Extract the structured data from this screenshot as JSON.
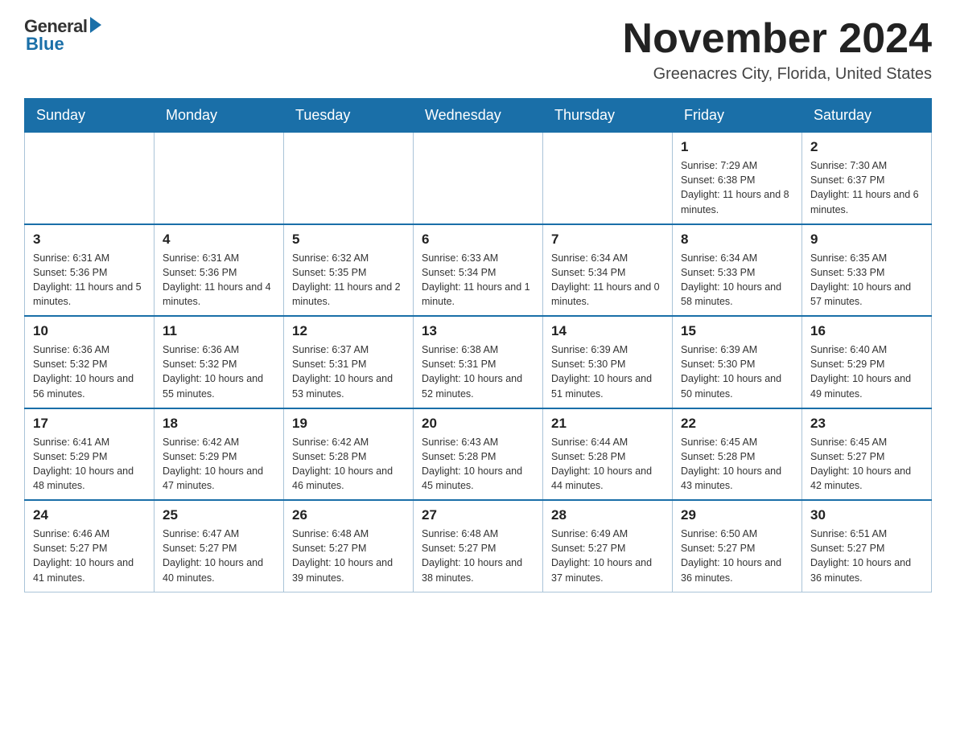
{
  "logo": {
    "general": "General",
    "blue": "Blue"
  },
  "title": "November 2024",
  "location": "Greenacres City, Florida, United States",
  "weekdays": [
    "Sunday",
    "Monday",
    "Tuesday",
    "Wednesday",
    "Thursday",
    "Friday",
    "Saturday"
  ],
  "weeks": [
    [
      {
        "day": "",
        "info": ""
      },
      {
        "day": "",
        "info": ""
      },
      {
        "day": "",
        "info": ""
      },
      {
        "day": "",
        "info": ""
      },
      {
        "day": "",
        "info": ""
      },
      {
        "day": "1",
        "info": "Sunrise: 7:29 AM\nSunset: 6:38 PM\nDaylight: 11 hours and 8 minutes."
      },
      {
        "day": "2",
        "info": "Sunrise: 7:30 AM\nSunset: 6:37 PM\nDaylight: 11 hours and 6 minutes."
      }
    ],
    [
      {
        "day": "3",
        "info": "Sunrise: 6:31 AM\nSunset: 5:36 PM\nDaylight: 11 hours and 5 minutes."
      },
      {
        "day": "4",
        "info": "Sunrise: 6:31 AM\nSunset: 5:36 PM\nDaylight: 11 hours and 4 minutes."
      },
      {
        "day": "5",
        "info": "Sunrise: 6:32 AM\nSunset: 5:35 PM\nDaylight: 11 hours and 2 minutes."
      },
      {
        "day": "6",
        "info": "Sunrise: 6:33 AM\nSunset: 5:34 PM\nDaylight: 11 hours and 1 minute."
      },
      {
        "day": "7",
        "info": "Sunrise: 6:34 AM\nSunset: 5:34 PM\nDaylight: 11 hours and 0 minutes."
      },
      {
        "day": "8",
        "info": "Sunrise: 6:34 AM\nSunset: 5:33 PM\nDaylight: 10 hours and 58 minutes."
      },
      {
        "day": "9",
        "info": "Sunrise: 6:35 AM\nSunset: 5:33 PM\nDaylight: 10 hours and 57 minutes."
      }
    ],
    [
      {
        "day": "10",
        "info": "Sunrise: 6:36 AM\nSunset: 5:32 PM\nDaylight: 10 hours and 56 minutes."
      },
      {
        "day": "11",
        "info": "Sunrise: 6:36 AM\nSunset: 5:32 PM\nDaylight: 10 hours and 55 minutes."
      },
      {
        "day": "12",
        "info": "Sunrise: 6:37 AM\nSunset: 5:31 PM\nDaylight: 10 hours and 53 minutes."
      },
      {
        "day": "13",
        "info": "Sunrise: 6:38 AM\nSunset: 5:31 PM\nDaylight: 10 hours and 52 minutes."
      },
      {
        "day": "14",
        "info": "Sunrise: 6:39 AM\nSunset: 5:30 PM\nDaylight: 10 hours and 51 minutes."
      },
      {
        "day": "15",
        "info": "Sunrise: 6:39 AM\nSunset: 5:30 PM\nDaylight: 10 hours and 50 minutes."
      },
      {
        "day": "16",
        "info": "Sunrise: 6:40 AM\nSunset: 5:29 PM\nDaylight: 10 hours and 49 minutes."
      }
    ],
    [
      {
        "day": "17",
        "info": "Sunrise: 6:41 AM\nSunset: 5:29 PM\nDaylight: 10 hours and 48 minutes."
      },
      {
        "day": "18",
        "info": "Sunrise: 6:42 AM\nSunset: 5:29 PM\nDaylight: 10 hours and 47 minutes."
      },
      {
        "day": "19",
        "info": "Sunrise: 6:42 AM\nSunset: 5:28 PM\nDaylight: 10 hours and 46 minutes."
      },
      {
        "day": "20",
        "info": "Sunrise: 6:43 AM\nSunset: 5:28 PM\nDaylight: 10 hours and 45 minutes."
      },
      {
        "day": "21",
        "info": "Sunrise: 6:44 AM\nSunset: 5:28 PM\nDaylight: 10 hours and 44 minutes."
      },
      {
        "day": "22",
        "info": "Sunrise: 6:45 AM\nSunset: 5:28 PM\nDaylight: 10 hours and 43 minutes."
      },
      {
        "day": "23",
        "info": "Sunrise: 6:45 AM\nSunset: 5:27 PM\nDaylight: 10 hours and 42 minutes."
      }
    ],
    [
      {
        "day": "24",
        "info": "Sunrise: 6:46 AM\nSunset: 5:27 PM\nDaylight: 10 hours and 41 minutes."
      },
      {
        "day": "25",
        "info": "Sunrise: 6:47 AM\nSunset: 5:27 PM\nDaylight: 10 hours and 40 minutes."
      },
      {
        "day": "26",
        "info": "Sunrise: 6:48 AM\nSunset: 5:27 PM\nDaylight: 10 hours and 39 minutes."
      },
      {
        "day": "27",
        "info": "Sunrise: 6:48 AM\nSunset: 5:27 PM\nDaylight: 10 hours and 38 minutes."
      },
      {
        "day": "28",
        "info": "Sunrise: 6:49 AM\nSunset: 5:27 PM\nDaylight: 10 hours and 37 minutes."
      },
      {
        "day": "29",
        "info": "Sunrise: 6:50 AM\nSunset: 5:27 PM\nDaylight: 10 hours and 36 minutes."
      },
      {
        "day": "30",
        "info": "Sunrise: 6:51 AM\nSunset: 5:27 PM\nDaylight: 10 hours and 36 minutes."
      }
    ]
  ]
}
